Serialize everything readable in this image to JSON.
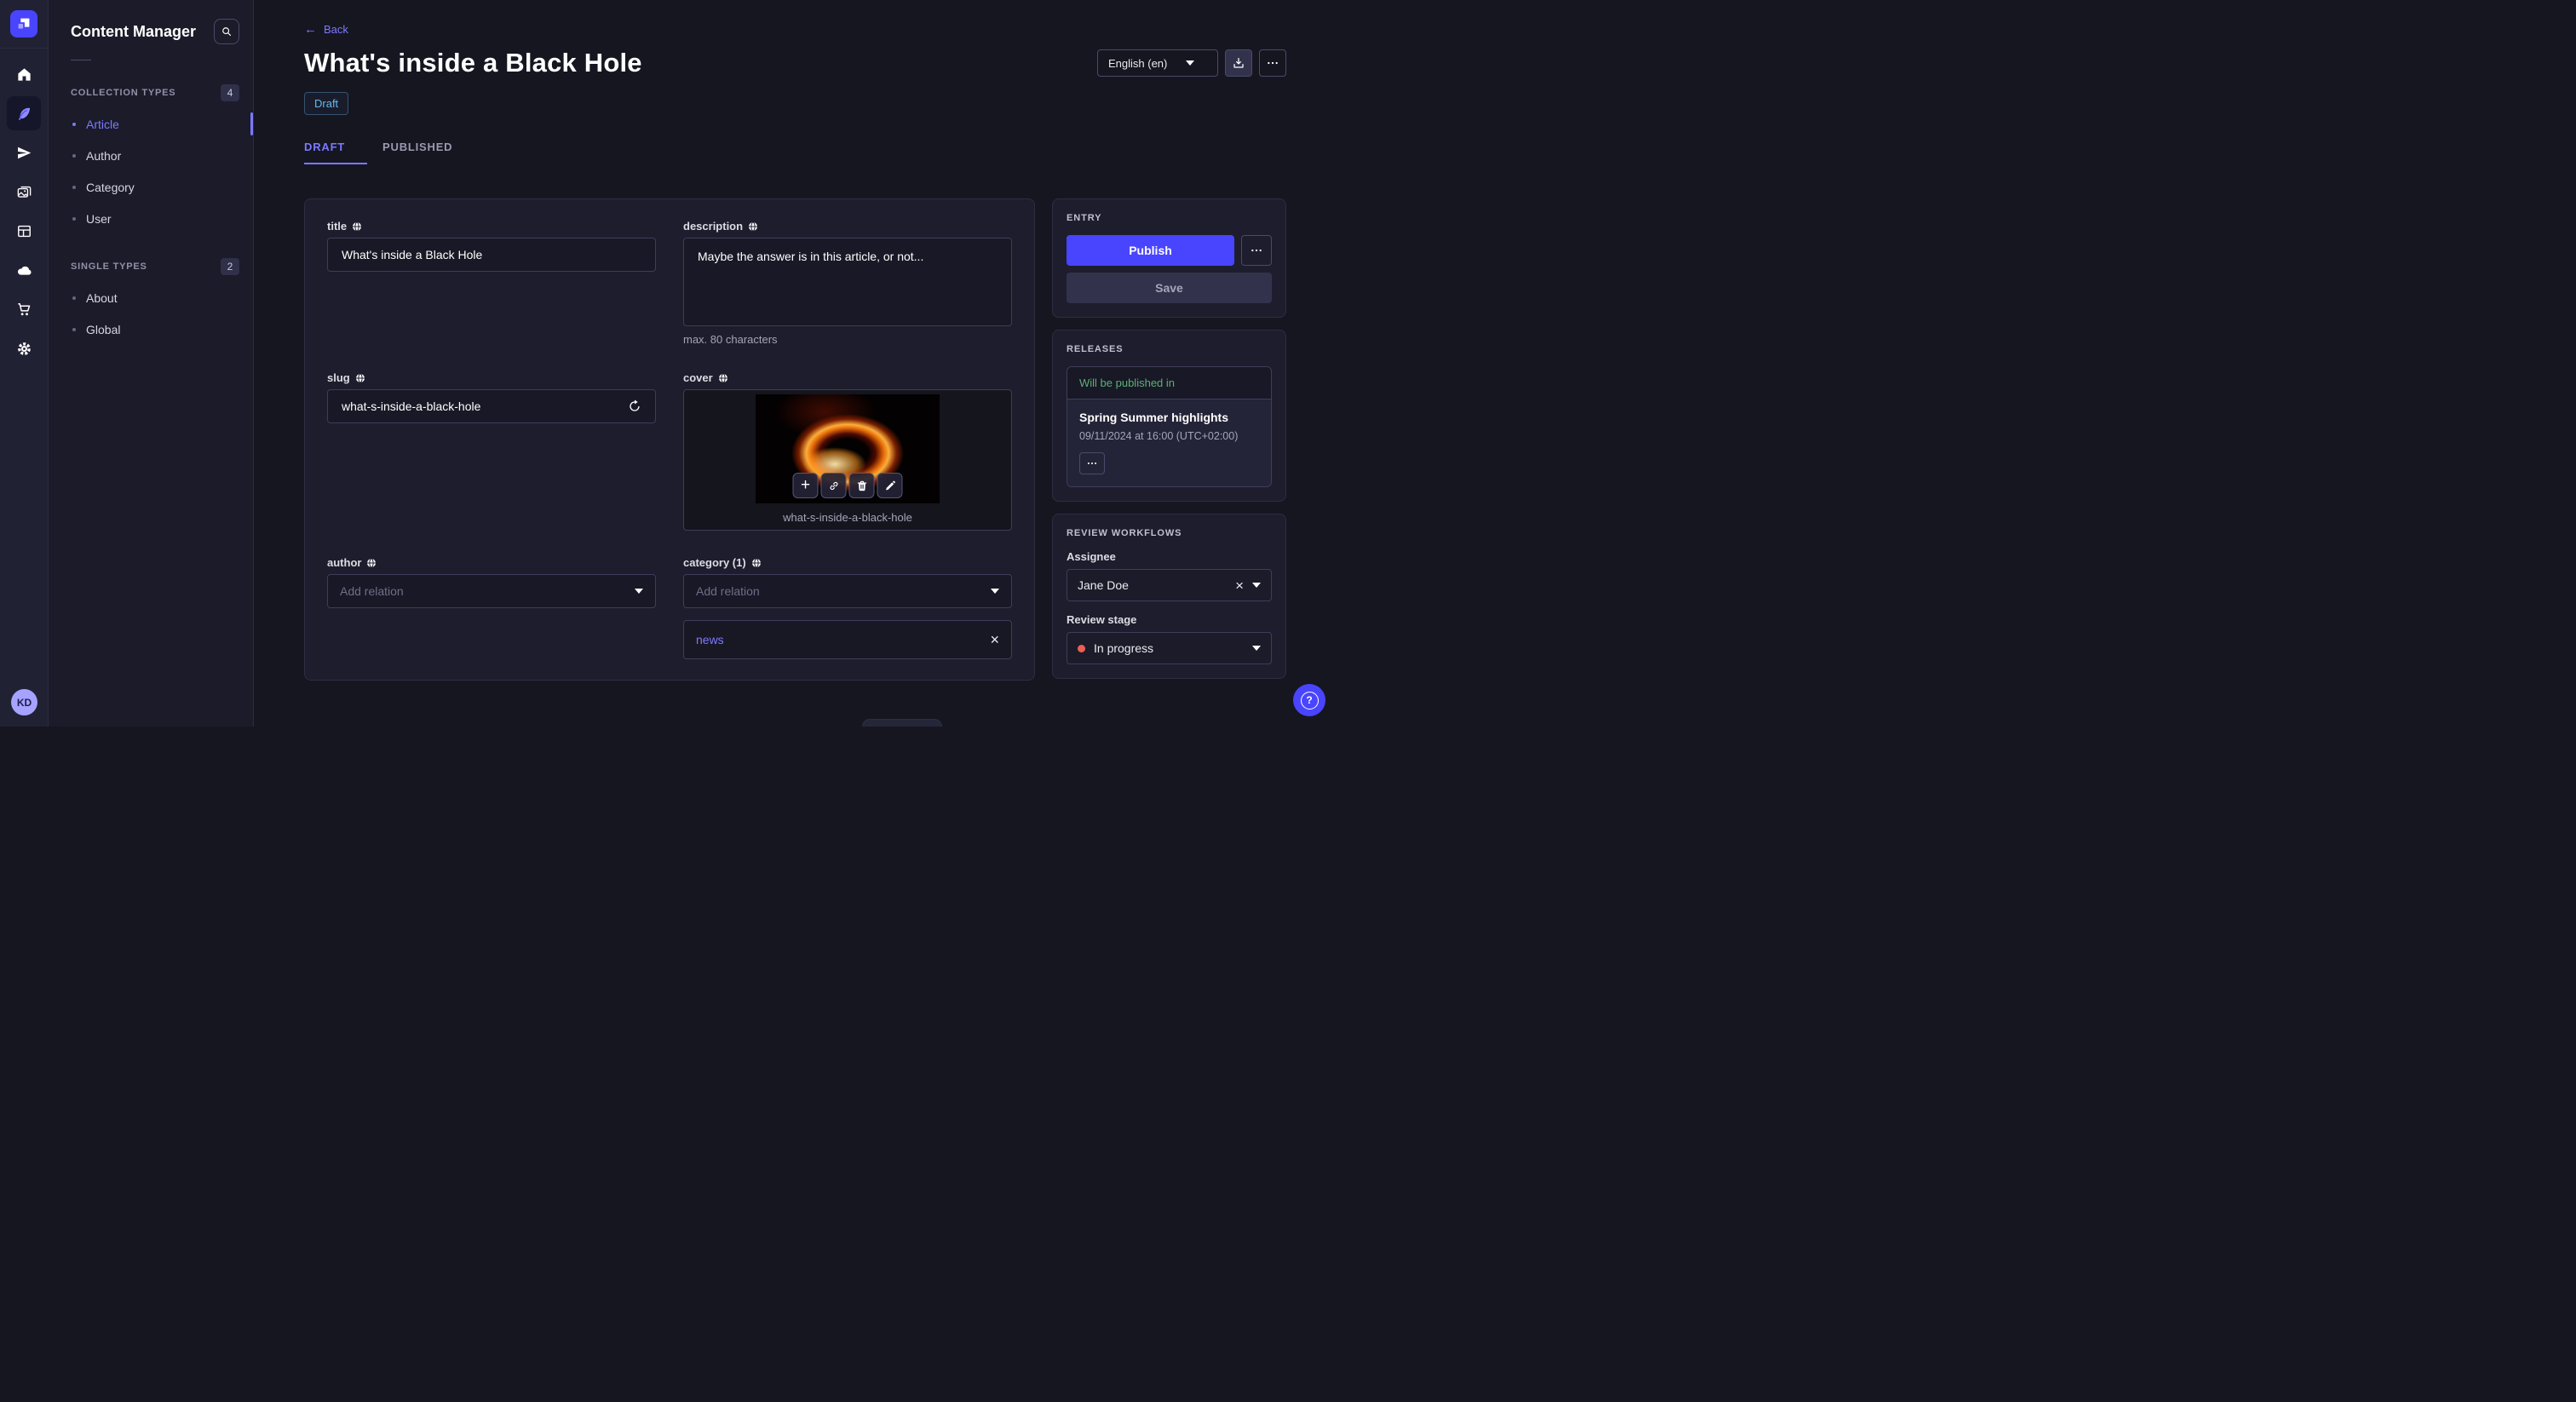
{
  "colors": {
    "accent": "#4945ff",
    "accent_light": "#7b79ff",
    "draft_blue": "#66b7f1",
    "success_green": "#5cb176",
    "danger_red": "#ee5e52"
  },
  "rail": {
    "avatar_initials": "KD"
  },
  "subnav": {
    "title": "Content Manager",
    "sections": [
      {
        "label": "COLLECTION TYPES",
        "count": "4",
        "items": [
          {
            "label": "Article"
          },
          {
            "label": "Author"
          },
          {
            "label": "Category"
          },
          {
            "label": "User"
          }
        ]
      },
      {
        "label": "SINGLE TYPES",
        "count": "2",
        "items": [
          {
            "label": "About"
          },
          {
            "label": "Global"
          }
        ]
      }
    ]
  },
  "header": {
    "back": "Back",
    "title": "What's inside a Black Hole",
    "status": "Draft",
    "locale": "English (en)"
  },
  "tabs": {
    "draft": "DRAFT",
    "published": "PUBLISHED"
  },
  "form": {
    "title": {
      "label": "title",
      "value": "What's inside a Black Hole"
    },
    "description": {
      "label": "description",
      "value": "Maybe the answer is in this article, or not...",
      "hint": "max. 80 characters"
    },
    "slug": {
      "label": "slug",
      "value": "what-s-inside-a-black-hole"
    },
    "cover": {
      "label": "cover",
      "caption": "what-s-inside-a-black-hole"
    },
    "author": {
      "label": "author",
      "placeholder": "Add relation"
    },
    "category": {
      "label": "category (1)",
      "placeholder": "Add relation",
      "relation": "news"
    }
  },
  "entry": {
    "title": "ENTRY",
    "publish": "Publish",
    "save": "Save"
  },
  "releases": {
    "title": "RELEASES",
    "header": "Will be published in",
    "name": "Spring Summer highlights",
    "date": "09/11/2024 at 16:00 (UTC+02:00)"
  },
  "review": {
    "title": "REVIEW WORKFLOWS",
    "assignee_label": "Assignee",
    "assignee": "Jane Doe",
    "stage_label": "Review stage",
    "stage": "In progress"
  }
}
